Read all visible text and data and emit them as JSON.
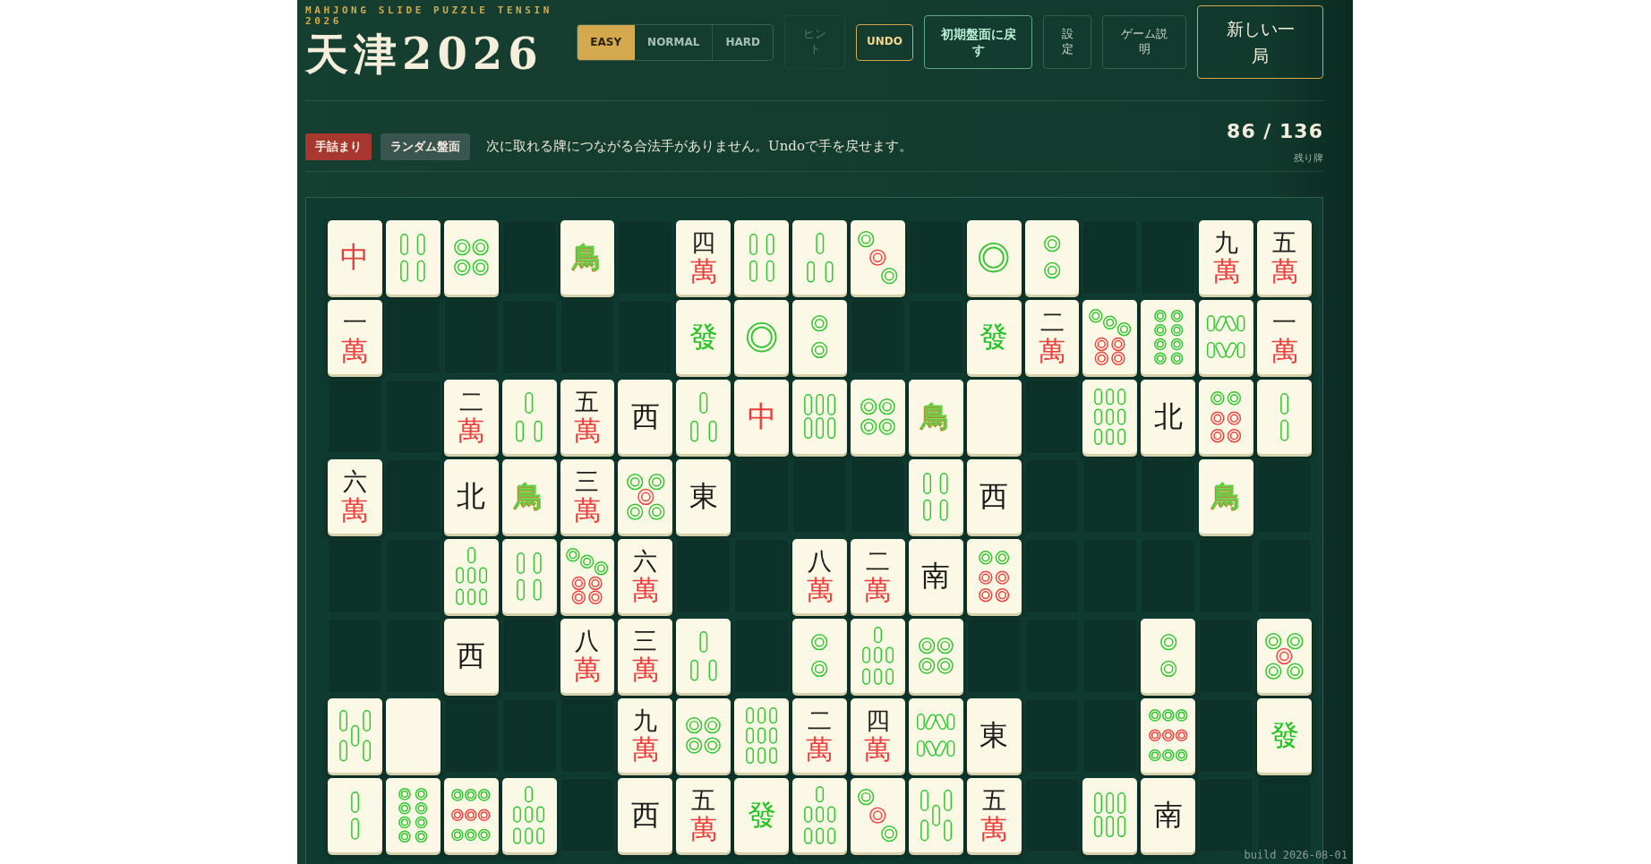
{
  "header": {
    "subtitle": "MAHJONG SLIDE PUZZLE TENSIN 2026",
    "title": "天津2026"
  },
  "difficulty": [
    {
      "label": "EASY",
      "selected": true
    },
    {
      "label": "NORMAL",
      "selected": false
    },
    {
      "label": "HARD",
      "selected": false
    }
  ],
  "actions": [
    {
      "label": "ヒント",
      "kind": "plain",
      "disabled": true
    },
    {
      "label": "UNDO",
      "kind": "gold",
      "disabled": false
    },
    {
      "label": "初期盤面に戻す",
      "kind": "green",
      "disabled": false
    },
    {
      "label": "設定",
      "kind": "plain",
      "disabled": false
    },
    {
      "label": "ゲーム説明",
      "kind": "plain",
      "disabled": false
    },
    {
      "label": "新しい一局",
      "kind": "primary",
      "disabled": false
    }
  ],
  "status": {
    "badges": [
      {
        "label": "手詰まり",
        "color": "#a8372f"
      },
      {
        "label": "ランダム盤面",
        "color": "#3a5550"
      }
    ],
    "message": "次に取れる牌につながる合法手がありません。Undoで手を戻せます。",
    "count": "86 / 136",
    "count_label": "残り牌"
  },
  "board": {
    "rows": [
      {
        "cells": [
          {
            "kind": "honor",
            "glyph": "中",
            "color": "#e83b3b"
          },
          {
            "kind": "sou4"
          },
          {
            "kind": "pin4"
          },
          {
            "kind": "empty"
          },
          {
            "kind": "bird",
            "glyph": "鳥"
          },
          {
            "kind": "empty"
          },
          {
            "kind": "man",
            "numeral": "四",
            "suit": "萬"
          },
          {
            "kind": "sou4"
          },
          {
            "kind": "sou3"
          },
          {
            "kind": "pin3"
          },
          {
            "kind": "empty"
          },
          {
            "kind": "pin1"
          },
          {
            "kind": "pin2"
          },
          {
            "kind": "empty"
          },
          {
            "kind": "empty"
          },
          {
            "kind": "man",
            "numeral": "九",
            "suit": "萬"
          },
          {
            "kind": "man",
            "numeral": "五",
            "suit": "萬"
          }
        ]
      },
      {
        "cells": [
          {
            "kind": "man",
            "numeral": "一",
            "suit": "萬"
          },
          {
            "kind": "empty"
          },
          {
            "kind": "empty"
          },
          {
            "kind": "empty"
          },
          {
            "kind": "empty"
          },
          {
            "kind": "empty"
          },
          {
            "kind": "honor",
            "glyph": "發",
            "color": "#22c322"
          },
          {
            "kind": "pin1"
          },
          {
            "kind": "pin2"
          },
          {
            "kind": "empty"
          },
          {
            "kind": "empty"
          },
          {
            "kind": "honor",
            "glyph": "發",
            "color": "#22c322"
          },
          {
            "kind": "man",
            "numeral": "二",
            "suit": "萬"
          },
          {
            "kind": "pin7"
          },
          {
            "kind": "pin8"
          },
          {
            "kind": "sou8"
          },
          {
            "kind": "man",
            "numeral": "一",
            "suit": "萬"
          }
        ]
      },
      {
        "cells": [
          {
            "kind": "empty"
          },
          {
            "kind": "empty"
          },
          {
            "kind": "man",
            "numeral": "二",
            "suit": "萬"
          },
          {
            "kind": "sou3"
          },
          {
            "kind": "man",
            "numeral": "五",
            "suit": "萬"
          },
          {
            "kind": "honor",
            "glyph": "西",
            "color": "#1a1a1a"
          },
          {
            "kind": "sou3"
          },
          {
            "kind": "honor",
            "glyph": "中",
            "color": "#e83b3b"
          },
          {
            "kind": "sou6"
          },
          {
            "kind": "pin4"
          },
          {
            "kind": "bird",
            "glyph": "鳥"
          },
          {
            "kind": "white"
          },
          {
            "kind": "empty"
          },
          {
            "kind": "sou9"
          },
          {
            "kind": "honor",
            "glyph": "北",
            "color": "#1a1a1a"
          },
          {
            "kind": "pin6"
          },
          {
            "kind": "sou2"
          }
        ]
      },
      {
        "cells": [
          {
            "kind": "man",
            "numeral": "六",
            "suit": "萬"
          },
          {
            "kind": "empty"
          },
          {
            "kind": "honor",
            "glyph": "北",
            "color": "#1a1a1a"
          },
          {
            "kind": "bird",
            "glyph": "鳥"
          },
          {
            "kind": "man",
            "numeral": "三",
            "suit": "萬"
          },
          {
            "kind": "pin5"
          },
          {
            "kind": "honor",
            "glyph": "東",
            "color": "#1a1a1a"
          },
          {
            "kind": "empty"
          },
          {
            "kind": "empty"
          },
          {
            "kind": "empty"
          },
          {
            "kind": "sou4"
          },
          {
            "kind": "honor",
            "glyph": "西",
            "color": "#1a1a1a"
          },
          {
            "kind": "empty"
          },
          {
            "kind": "empty"
          },
          {
            "kind": "empty"
          },
          {
            "kind": "bird",
            "glyph": "鳥"
          },
          {
            "kind": "empty"
          }
        ]
      },
      {
        "cells": [
          {
            "kind": "empty"
          },
          {
            "kind": "empty"
          },
          {
            "kind": "sou7"
          },
          {
            "kind": "sou4"
          },
          {
            "kind": "pin7"
          },
          {
            "kind": "man",
            "numeral": "六",
            "suit": "萬"
          },
          {
            "kind": "empty"
          },
          {
            "kind": "empty"
          },
          {
            "kind": "man",
            "numeral": "八",
            "suit": "萬"
          },
          {
            "kind": "man",
            "numeral": "二",
            "suit": "萬"
          },
          {
            "kind": "honor",
            "glyph": "南",
            "color": "#1a1a1a"
          },
          {
            "kind": "pin6"
          },
          {
            "kind": "empty"
          },
          {
            "kind": "empty"
          },
          {
            "kind": "empty"
          },
          {
            "kind": "empty"
          },
          {
            "kind": "empty"
          }
        ]
      },
      {
        "cells": [
          {
            "kind": "empty"
          },
          {
            "kind": "empty"
          },
          {
            "kind": "honor",
            "glyph": "西",
            "color": "#1a1a1a"
          },
          {
            "kind": "empty"
          },
          {
            "kind": "man",
            "numeral": "八",
            "suit": "萬"
          },
          {
            "kind": "man",
            "numeral": "三",
            "suit": "萬"
          },
          {
            "kind": "sou3"
          },
          {
            "kind": "empty"
          },
          {
            "kind": "pin2"
          },
          {
            "kind": "sou7"
          },
          {
            "kind": "pin4"
          },
          {
            "kind": "empty"
          },
          {
            "kind": "empty"
          },
          {
            "kind": "empty"
          },
          {
            "kind": "pin2"
          },
          {
            "kind": "empty"
          },
          {
            "kind": "pin5"
          }
        ]
      },
      {
        "cells": [
          {
            "kind": "sou5"
          },
          {
            "kind": "white"
          },
          {
            "kind": "empty"
          },
          {
            "kind": "empty"
          },
          {
            "kind": "empty"
          },
          {
            "kind": "man",
            "numeral": "九",
            "suit": "萬"
          },
          {
            "kind": "pin4"
          },
          {
            "kind": "sou9"
          },
          {
            "kind": "man",
            "numeral": "二",
            "suit": "萬"
          },
          {
            "kind": "man",
            "numeral": "四",
            "suit": "萬"
          },
          {
            "kind": "sou8"
          },
          {
            "kind": "honor",
            "glyph": "東",
            "color": "#1a1a1a"
          },
          {
            "kind": "empty"
          },
          {
            "kind": "empty"
          },
          {
            "kind": "pin9"
          },
          {
            "kind": "empty"
          },
          {
            "kind": "honor",
            "glyph": "發",
            "color": "#22c322"
          }
        ]
      },
      {
        "cells": [
          {
            "kind": "sou2"
          },
          {
            "kind": "pin8"
          },
          {
            "kind": "pin9"
          },
          {
            "kind": "sou7"
          },
          {
            "kind": "empty"
          },
          {
            "kind": "honor",
            "glyph": "西",
            "color": "#1a1a1a"
          },
          {
            "kind": "man",
            "numeral": "五",
            "suit": "萬"
          },
          {
            "kind": "honor",
            "glyph": "發",
            "color": "#22c322"
          },
          {
            "kind": "sou7"
          },
          {
            "kind": "pin3"
          },
          {
            "kind": "sou5"
          },
          {
            "kind": "man",
            "numeral": "五",
            "suit": "萬"
          },
          {
            "kind": "empty"
          },
          {
            "kind": "sou6"
          },
          {
            "kind": "honor",
            "glyph": "南",
            "color": "#1a1a1a"
          },
          {
            "kind": "empty"
          },
          {
            "kind": "empty"
          }
        ]
      }
    ]
  },
  "footer": {
    "build": "build 2026-08-01"
  }
}
